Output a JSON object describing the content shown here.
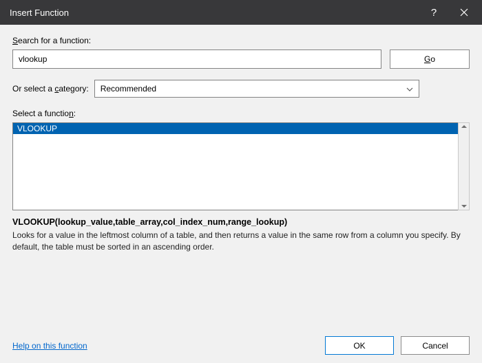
{
  "titlebar": {
    "title": "Insert Function"
  },
  "labels": {
    "search_html": "<span class='u'>S</span>earch for a function:",
    "category_html": "Or select a <span class='u'>c</span>ategory:",
    "select_fn_html": "Select a functio<span class='u'>n</span>:"
  },
  "search": {
    "value": "vlookup",
    "go_html": "<span class='u'>G</span>o"
  },
  "category": {
    "selected": "Recommended"
  },
  "listbox": {
    "items": [
      "VLOOKUP"
    ]
  },
  "preview": {
    "signature": "VLOOKUP(lookup_value,table_array,col_index_num,range_lookup)",
    "description": "Looks for a value in the leftmost column of a table, and then returns a value in the same row from a column you specify. By default, the table must be sorted in an ascending order."
  },
  "footer": {
    "help": "Help on this function",
    "ok": "OK",
    "cancel": "Cancel"
  }
}
